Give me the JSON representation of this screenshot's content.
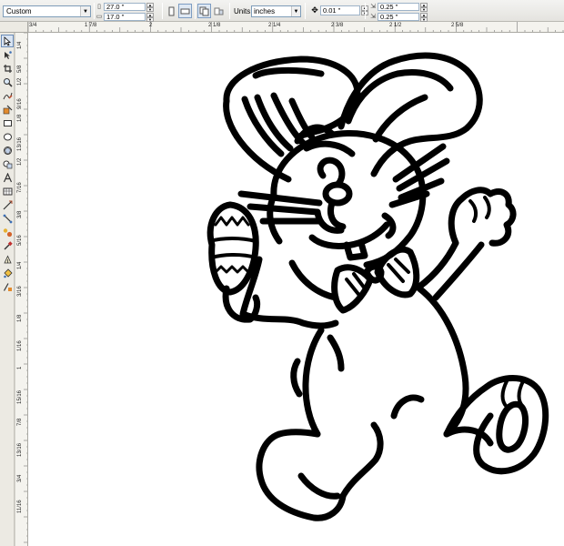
{
  "property_bar": {
    "paper_preset": "Custom",
    "width": "27.0 \"",
    "height": "17.0 \"",
    "units_label": "Units:",
    "units_value": "inches",
    "nudge": "0.01 \"",
    "duplicate_x": "0.25 \"",
    "duplicate_y": "0.25 \""
  },
  "horizontal_ruler": {
    "labels": [
      "3/4",
      "1 7/8",
      "2",
      "2 1/8",
      "2 1/4",
      "2 3/8",
      "2 1/2",
      "2 5/8"
    ]
  },
  "vertical_ruler": {
    "labels": [
      "1/4",
      "5/8",
      "1/2",
      "9/16",
      "1/8",
      "13/16",
      "1/2",
      "7/16",
      "3/8",
      "5/16",
      "1/4",
      "3/16",
      "1/8",
      "1/16",
      "1",
      "15/16",
      "7/8",
      "13/16",
      "3/4",
      "11/16"
    ]
  },
  "toolbox": {
    "tools": [
      "pick-tool",
      "shape-tool",
      "crop-tool",
      "zoom-tool",
      "freehand-tool",
      "smart-fill-tool",
      "rectangle-tool",
      "ellipse-tool",
      "polygon-tool",
      "basic-shapes-tool",
      "text-tool",
      "table-tool",
      "dimension-tool",
      "connector-tool",
      "blend-tool",
      "color-eyedropper-tool",
      "outline-tool",
      "fill-tool",
      "interactive-fill-tool"
    ]
  },
  "canvas": {
    "artwork": "easter-bunny-outline",
    "stroke_color": "#000000",
    "background_color": "#ffffff"
  }
}
